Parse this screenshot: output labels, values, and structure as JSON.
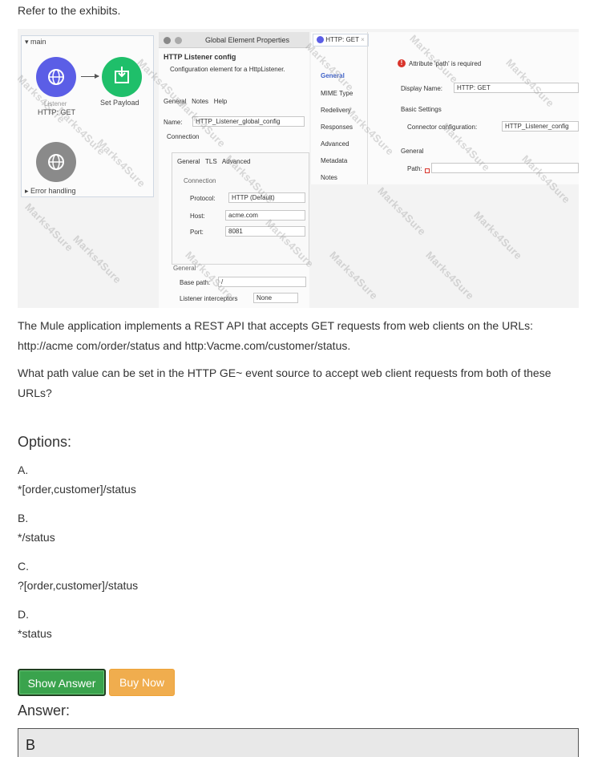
{
  "intro": "Refer to the exhibits.",
  "exhibit": {
    "flow": {
      "main_label": "main",
      "listener_caption": "Listener",
      "listener_label": "HTTP: GET",
      "set_payload_label": "Set Payload",
      "error_handling_label": "Error handling"
    },
    "global_element": {
      "window_title": "Global Element Properties",
      "heading": "HTTP Listener config",
      "description": "Configuration element for a HttpListener.",
      "tabs": [
        "General",
        "Notes",
        "Help"
      ],
      "name_label": "Name:",
      "name_value": "HTTP_Listener_global_config",
      "connection_label": "Connection",
      "inner_tabs": [
        "General",
        "TLS",
        "Advanced"
      ],
      "connection_header": "Connection",
      "protocol_label": "Protocol:",
      "protocol_value": "HTTP (Default)",
      "host_label": "Host:",
      "host_value": "acme.com",
      "port_label": "Port:",
      "port_value": "8081",
      "general_header": "General",
      "base_path_label": "Base path:",
      "base_path_value": "/",
      "interceptors_label": "Listener interceptors",
      "interceptors_value": "None"
    },
    "http_get": {
      "tab_title": "HTTP: GET",
      "nav_items": [
        "General",
        "MIME Type",
        "Redelivery",
        "Responses",
        "Advanced",
        "Metadata",
        "Notes"
      ],
      "error_message": "Attribute 'path' is required",
      "display_name_label": "Display Name:",
      "display_name_value": "HTTP: GET",
      "basic_settings_label": "Basic Settings",
      "connector_config_label": "Connector configuration:",
      "connector_config_value": "HTTP_Listener_config",
      "general_label": "General",
      "path_label": "Path:"
    },
    "watermark": "Marks4Sure"
  },
  "question": {
    "paragraph1": "The Mule application implements a REST API that accepts GET requests from web clients on the URLs: http://acme com/order/status and http:Vacme.com/customer/status.",
    "paragraph2": "What path value can be set in the HTTP GE~ event source to accept web client requests from both of these URLs?"
  },
  "options_title": "Options:",
  "options": [
    {
      "letter": "A.",
      "text": "*[order,customer]/status"
    },
    {
      "letter": "B.",
      "text": "*/status"
    },
    {
      "letter": "C.",
      "text": "?[order,customer]/status"
    },
    {
      "letter": "D.",
      "text": "*status"
    }
  ],
  "buttons": {
    "show_answer": "Show Answer",
    "buy_now": "Buy Now"
  },
  "answer_label": "Answer:",
  "answer_value": "B",
  "colors": {
    "show_answer_bg": "#3aa34d",
    "buy_now_bg": "#f0ad4e",
    "listener_icon": "#5b5ee6",
    "set_payload_icon": "#1fbf6a",
    "error_icon": "#d9342b"
  }
}
